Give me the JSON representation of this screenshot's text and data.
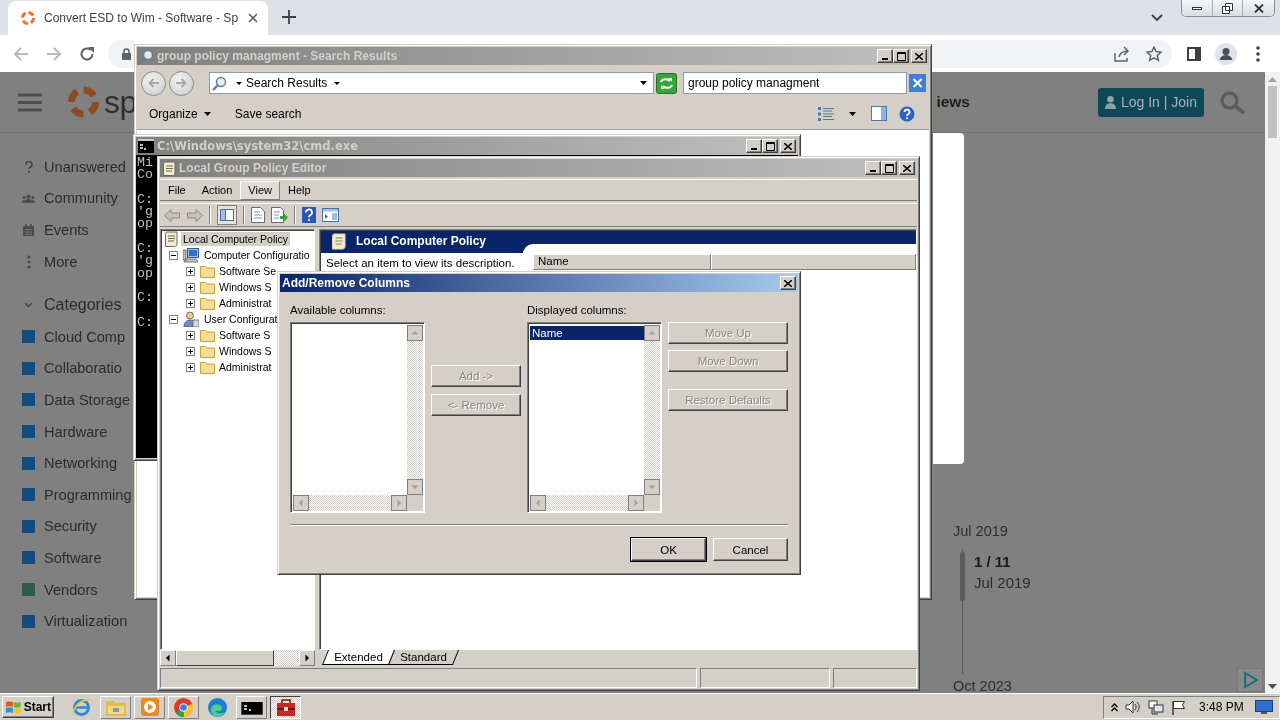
{
  "browser": {
    "tab_title": "Convert ESD to Wim - Software - Sp",
    "back_disabled": true,
    "forward_disabled": true
  },
  "page": {
    "logo_text": "sp",
    "nav_fragment": "iews",
    "login_button": "Log In | Join",
    "nav_items": [
      "Unanswered",
      "Community",
      "Events",
      "More"
    ],
    "categories": {
      "label": "Categories",
      "expanded": true,
      "items": [
        {
          "label": "Cloud Comp",
          "color": "#154c7b"
        },
        {
          "label": "Collaboratio",
          "color": "#154c7b"
        },
        {
          "label": "Data Storage",
          "color": "#154c7b"
        },
        {
          "label": "Hardware",
          "color": "#154c7b"
        },
        {
          "label": "Networking",
          "color": "#154c7b"
        },
        {
          "label": "Programming",
          "color": "#154c7b"
        },
        {
          "label": "Security",
          "color": "#154c7b"
        },
        {
          "label": "Software",
          "color": "#154c7b"
        },
        {
          "label": "Vendors",
          "color": "#2e5c44"
        },
        {
          "label": "Virtualization",
          "color": "#154c7b"
        }
      ]
    },
    "timeline": {
      "start": "Jul 2019",
      "position": "1 / 11",
      "position_date": "Jul 2019",
      "end": "Oct 2023"
    }
  },
  "search_window": {
    "title": "group policy managment - Search Results",
    "back_disabled": true,
    "forward_disabled": true,
    "location": "Search Results",
    "search_value": "group policy managment",
    "toolbar": [
      "Organize",
      "Save search"
    ]
  },
  "cmd_window": {
    "title": "C:\\Windows\\system32\\cmd.exe",
    "output_blocks": [
      [
        "Mi",
        "Co"
      ],
      [
        "C:",
        "'g",
        "op"
      ],
      [
        "C:",
        "'g",
        "op"
      ],
      [
        "C:"
      ],
      [
        "C:"
      ]
    ]
  },
  "policy_editor": {
    "title": "Local Group Policy Editor",
    "menu": [
      {
        "label": "File",
        "selected": false
      },
      {
        "label": "Action",
        "selected": false
      },
      {
        "label": "View",
        "selected": true
      },
      {
        "label": "Help",
        "selected": false
      }
    ],
    "back_disabled": true,
    "forward_disabled": true,
    "tree": {
      "label": "Local Computer Policy",
      "selected": true,
      "children": [
        {
          "label": "Computer Configuratio",
          "selected": false,
          "expanded": true,
          "children": [
            {
              "label": "Software Se",
              "selected": false,
              "expanded": false
            },
            {
              "label": "Windows S",
              "selected": false,
              "expanded": false
            },
            {
              "label": "Administrat",
              "selected": false,
              "expanded": false
            }
          ]
        },
        {
          "label": "User Configurat",
          "selected": false,
          "expanded": true,
          "children": [
            {
              "label": "Software S",
              "selected": false,
              "expanded": false
            },
            {
              "label": "Windows S",
              "selected": false,
              "expanded": false
            },
            {
              "label": "Administrat",
              "selected": false,
              "expanded": false
            }
          ]
        }
      ]
    },
    "pane_title": "Local Computer Policy",
    "description": "Select an item to view its description.",
    "columns": [
      "Name"
    ],
    "tabs": [
      {
        "label": "Extended",
        "selected": true
      },
      {
        "label": "Standard",
        "selected": false
      }
    ]
  },
  "dialog": {
    "title": "Add/Remove Columns",
    "available_label": "Available columns:",
    "transfer_buttons": [
      {
        "label": "Add ->",
        "disabled": true
      },
      {
        "label": "<- Remove",
        "disabled": true
      }
    ],
    "displayed_label": "Displayed columns:",
    "displayed_items": [
      {
        "label": "Name",
        "selected": true
      }
    ],
    "order_buttons": [
      {
        "label": "Move Up",
        "disabled": true
      },
      {
        "label": "Move Down",
        "disabled": true
      },
      {
        "label": "Restore Defaults",
        "disabled": true
      }
    ],
    "footer_buttons": [
      {
        "label": "OK",
        "disabled": false,
        "default": true
      },
      {
        "label": "Cancel",
        "disabled": false,
        "default": false
      }
    ]
  },
  "taskbar": {
    "start": "Start",
    "apps": [
      {
        "running": false,
        "selected": false
      },
      {
        "running": true,
        "selected": false
      },
      {
        "running": true,
        "selected": false
      },
      {
        "running": true,
        "selected": false
      },
      {
        "running": false,
        "selected": false
      },
      {
        "running": true,
        "selected": false
      },
      {
        "running": true,
        "selected": true
      }
    ],
    "clock": "3:48 PM"
  }
}
